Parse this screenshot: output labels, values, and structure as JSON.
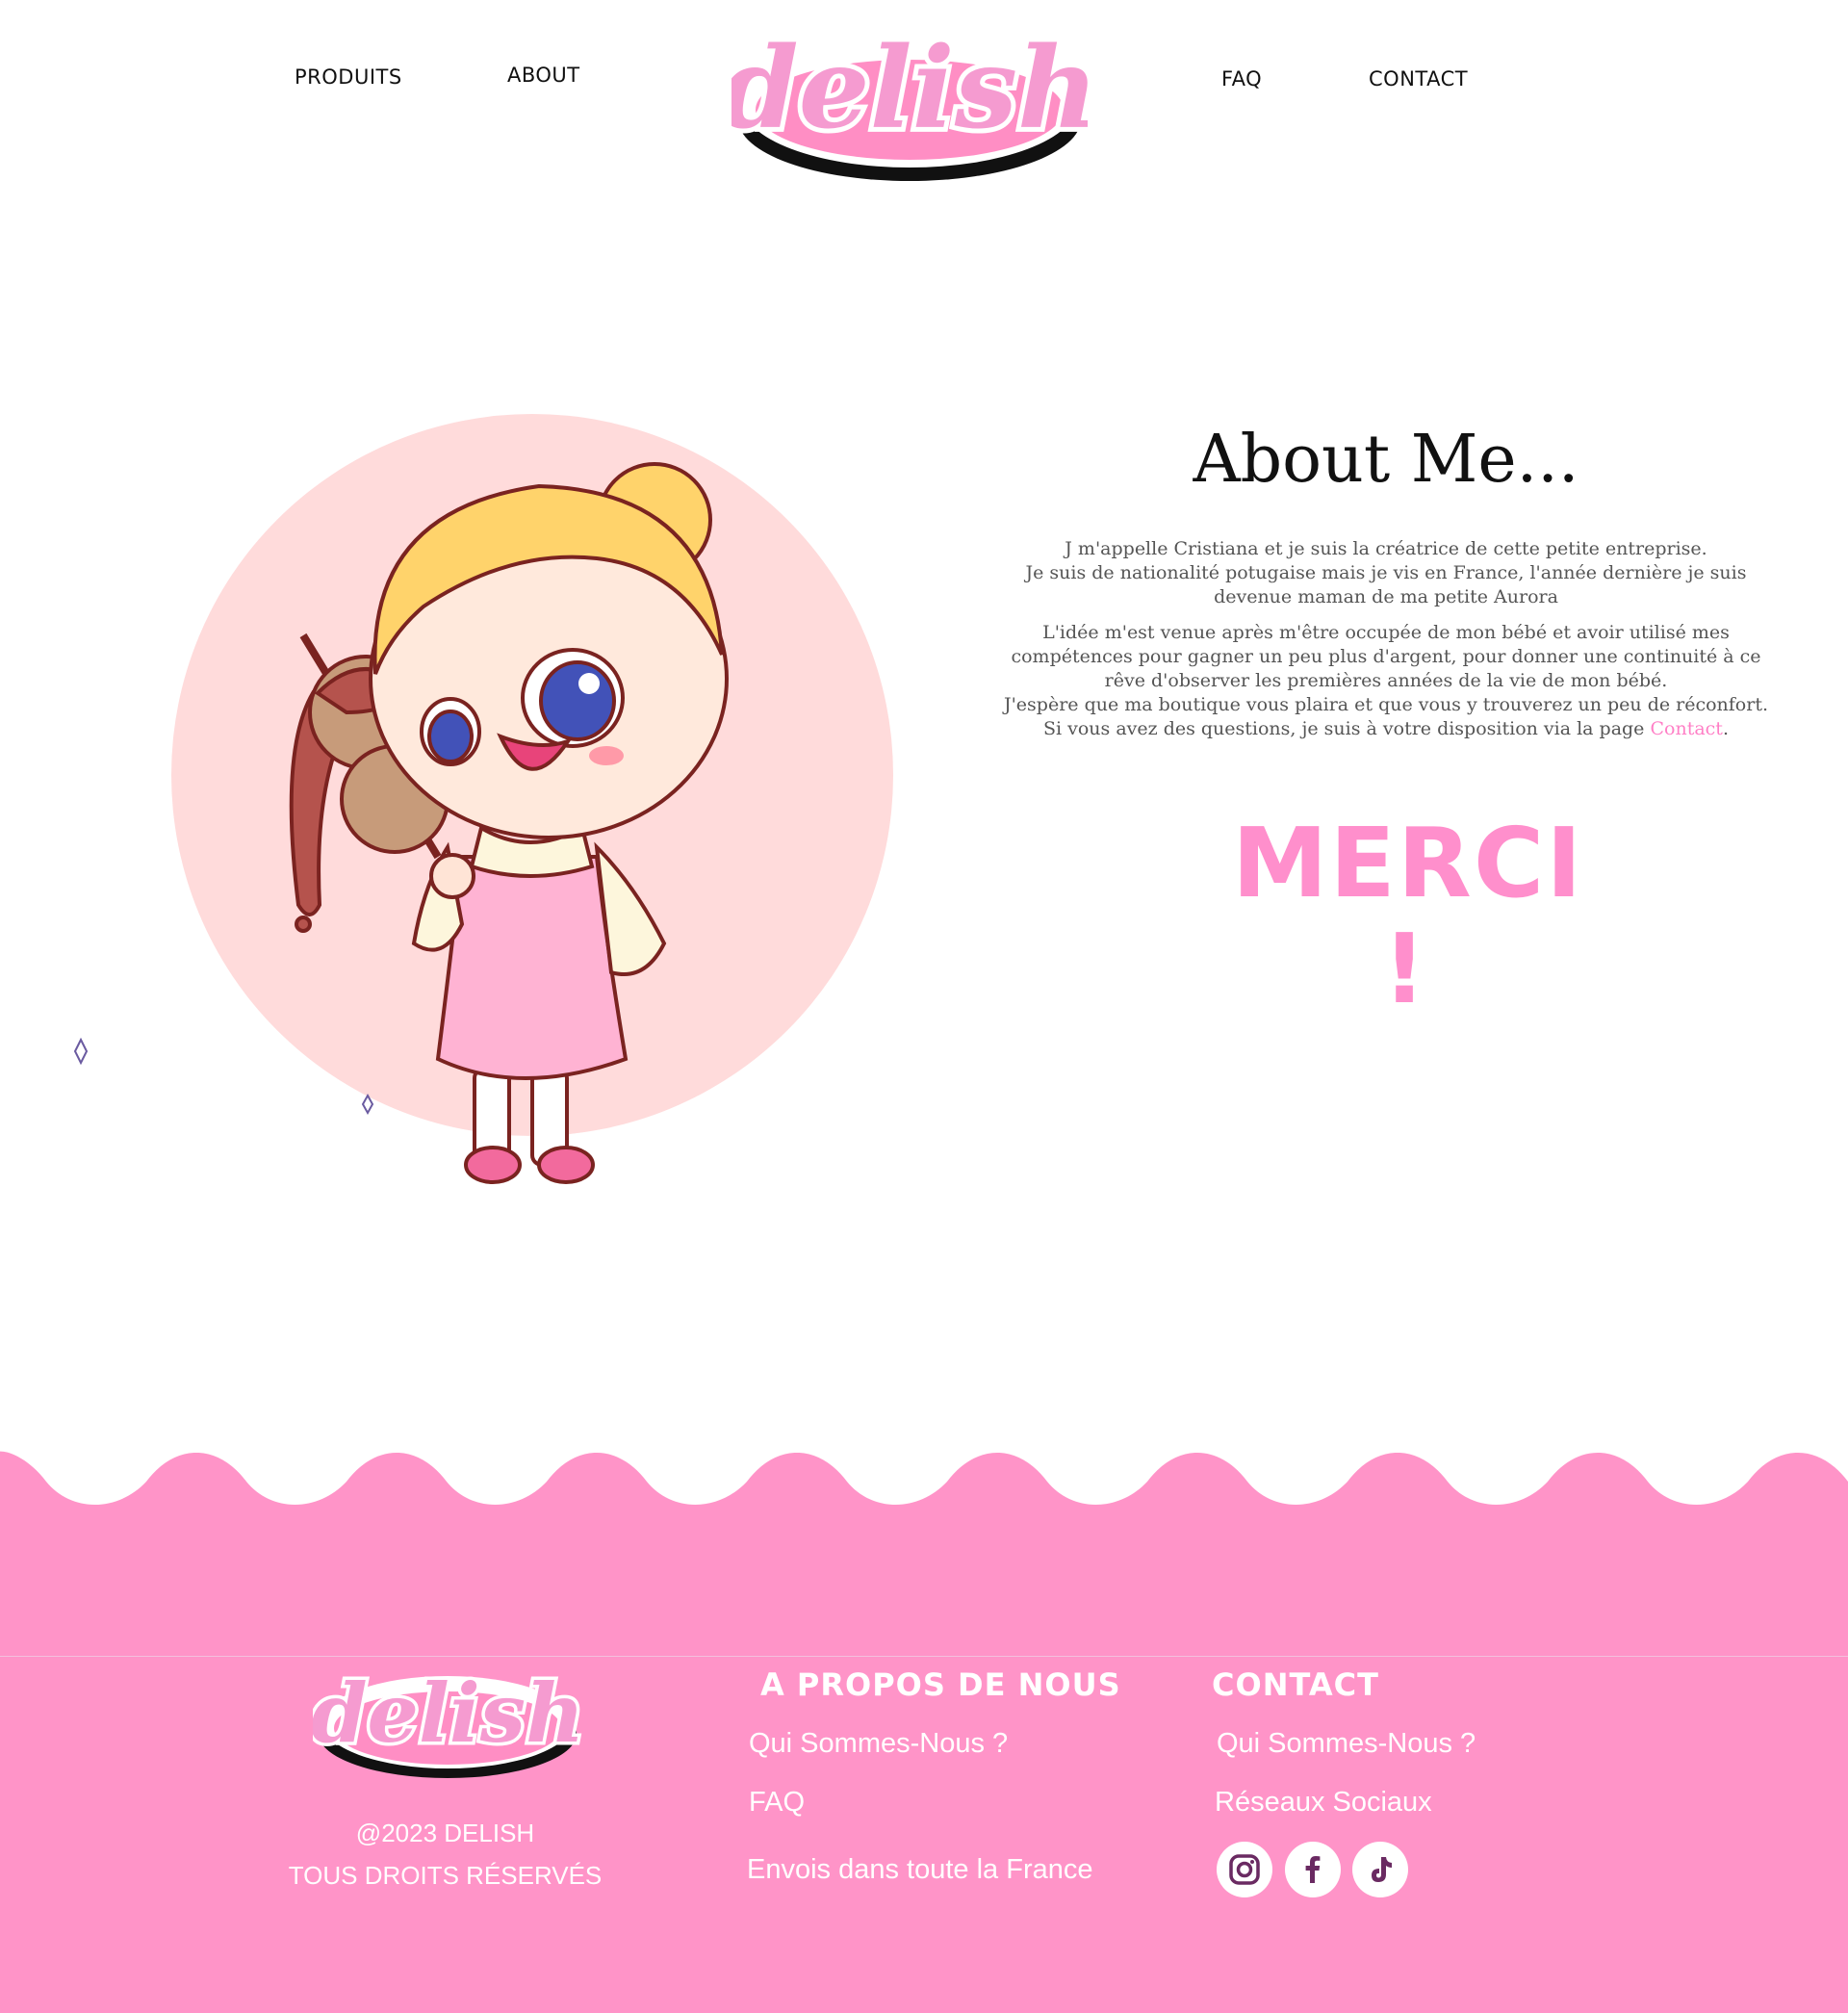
{
  "header": {
    "nav": {
      "produits": "PRODUITS",
      "about": "ABOUT",
      "faq": "FAQ",
      "contact": "CONTACT"
    },
    "logo_text": "delish"
  },
  "about": {
    "title": "About Me...",
    "paragraph1_line1": "J m'appelle Cristiana et je suis la créatrice de cette petite entreprise.",
    "paragraph1_line2": "Je suis de nationalité potugaise mais je vis en France, l'année dernière je suis devenue maman de ma petite Aurora",
    "paragraph2_a": "L'idée m'est venue après m'être occupée de mon bébé et avoir utilisé mes compétences pour gagner un peu plus d'argent, pour donner une continuité à ce rêve d'observer les premières années de la vie de mon bébé.",
    "paragraph2_b": "J'espère que ma boutique vous plaira et que vous y trouverez un peu de réconfort.",
    "paragraph2_c": "Si vous avez des questions, je suis à votre disposition via la page ",
    "contact_link": "Contact",
    "paragraph2_end": ".",
    "merci": "MERCI !"
  },
  "footer": {
    "logo_text": "delish",
    "copyright_year": "@2023",
    "copyright_brand": "DELISH",
    "rights": "TOUS DROITS RÉSERVÉS",
    "col1": {
      "heading": "A PROPOS DE NOUS",
      "links": [
        "Qui Sommes-Nous ?",
        "FAQ",
        "Envois dans toute la France"
      ]
    },
    "col2": {
      "heading": "CONTACT",
      "links": [
        "Qui Sommes-Nous ?",
        "Réseaux Sociaux"
      ]
    },
    "social_icons": [
      "instagram-icon",
      "facebook-icon",
      "tiktok-icon"
    ]
  },
  "colors": {
    "brand_pink": "#ff94c8",
    "merci_pink": "#ff8fcc",
    "link_pink": "#ff7fc6",
    "circle_pink": "#ffdbdb",
    "social_icon": "#6a2a62"
  }
}
